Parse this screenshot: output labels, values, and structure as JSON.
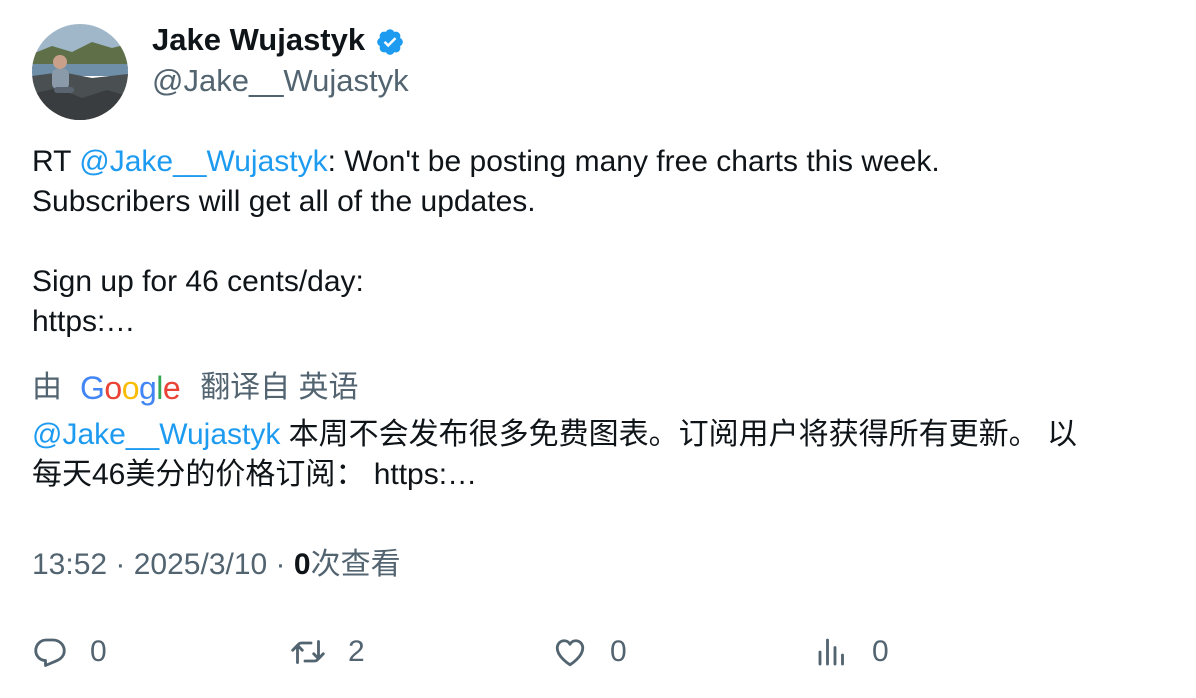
{
  "author": {
    "display_name": "Jake Wujastyk",
    "handle": "@Jake__Wujastyk",
    "verified_icon": "verified-badge-icon",
    "verified_color": "#1d9bf0"
  },
  "tweet": {
    "prefix": "RT ",
    "mention": "@Jake__Wujastyk",
    "line1_rest": ": Won't be posting many free charts this week.",
    "line2": "Subscribers will get all of the updates.",
    "line3": "Sign up for 46 cents/day:",
    "line4": "https:…"
  },
  "translation": {
    "by_label": "由",
    "google": [
      "G",
      "o",
      "o",
      "g",
      "l",
      "e"
    ],
    "translated_from_label": "翻译自 英语",
    "mention": "@Jake__Wujastyk",
    "line1_rest": " 本周不会发布很多免费图表。订阅用户将获得所有更新。 以",
    "line2": "每天46美分的价格订阅： https:…"
  },
  "meta": {
    "time": "13:52",
    "separator": " · ",
    "date": "2025/3/10",
    "views_count": "0",
    "views_label": "次查看"
  },
  "actions": {
    "reply": {
      "icon": "reply-icon",
      "count": "0"
    },
    "retweet": {
      "icon": "retweet-icon",
      "count": "2"
    },
    "like": {
      "icon": "heart-icon",
      "count": "0"
    },
    "views": {
      "icon": "analytics-icon",
      "count": "0"
    }
  },
  "colors": {
    "link": "#1d9bf0",
    "secondary_text": "#536471",
    "primary_text": "#0f1419"
  }
}
